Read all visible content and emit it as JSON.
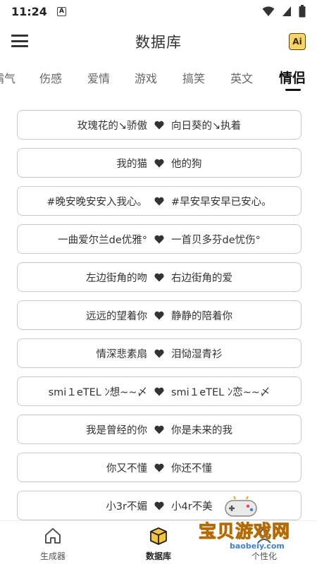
{
  "status_bar": {
    "time": "11:24",
    "notification_icon": "A"
  },
  "header": {
    "title": "数据库",
    "ai_label": "Ai"
  },
  "tabs": [
    {
      "label": "霸气"
    },
    {
      "label": "伤感"
    },
    {
      "label": "爱情"
    },
    {
      "label": "游戏"
    },
    {
      "label": "搞笑"
    },
    {
      "label": "英文"
    },
    {
      "label": "情侣",
      "active": true
    }
  ],
  "pairs": [
    {
      "left": "玫瑰花的↘骄傲",
      "right": "向日葵的↘执着"
    },
    {
      "left": "我的猫",
      "right": "他的狗"
    },
    {
      "left": "#晚安晚安安入我心。",
      "right": "#早安早安早已安心。"
    },
    {
      "left": "一曲爱尔兰de优雅°",
      "right": "一首贝多芬de忧伤°"
    },
    {
      "left": "左边街角的吻",
      "right": "右边街角的爱"
    },
    {
      "left": "远远的望着你",
      "right": "静静的陪着你"
    },
    {
      "left": "情深悲素扇",
      "right": "泪恸湿青衫"
    },
    {
      "left": "smi１eTEL ﾝ想~~〆",
      "right": "smi１eTEL ﾝ恋~~〆"
    },
    {
      "left": "我是曾经的你",
      "right": "你是未来的我"
    },
    {
      "left": "你又不懂",
      "right": "你还不懂"
    },
    {
      "left": "小3r不媚",
      "right": "小4r不美"
    }
  ],
  "bottom_nav": [
    {
      "label": "生成器",
      "icon": "home-icon"
    },
    {
      "label": "数据库",
      "icon": "database-box-icon",
      "active": true
    },
    {
      "label": "个性化",
      "icon": "personalize-icon"
    }
  ],
  "watermark": {
    "text": "宝贝游戏网",
    "url": "baobeiy.com"
  },
  "colors": {
    "heart": "#333333",
    "row_border": "#c9c9c9",
    "active_tab": "#111111",
    "watermark": "#f2a21a"
  }
}
